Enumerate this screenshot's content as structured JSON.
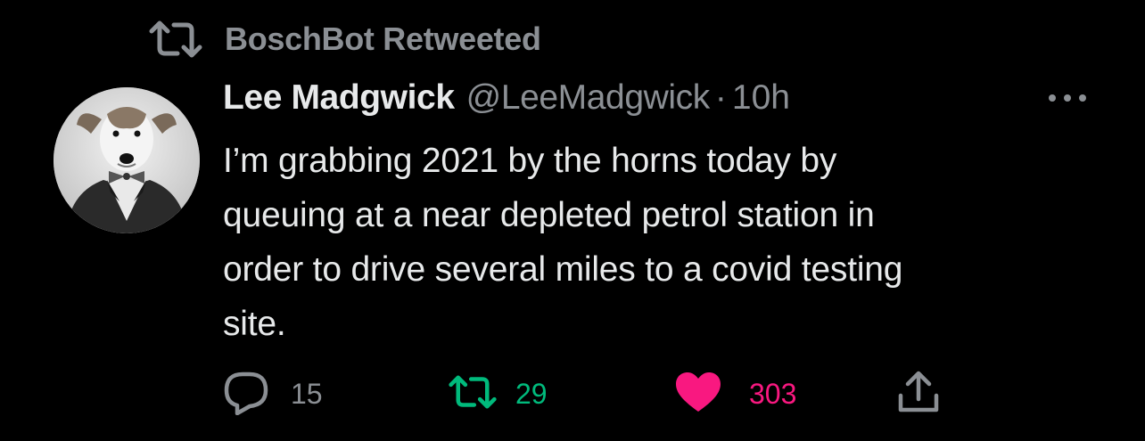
{
  "retweet_header": {
    "icon": "retweet-icon",
    "label": "BoschBot Retweeted"
  },
  "author": {
    "name": "Lee Madgwick",
    "handle": "@LeeMadgwick",
    "separator": "·",
    "time": "10h",
    "avatar": "dog-in-suit-avatar"
  },
  "tweet": {
    "lines": [
      "I’m grabbing 2021 by the horns today by",
      "queuing at a near depleted petrol station in",
      "order to drive several miles to a covid testing",
      "site."
    ]
  },
  "actions": {
    "reply": {
      "icon": "reply-icon",
      "count": "15"
    },
    "retweet": {
      "icon": "retweet-icon",
      "count": "29",
      "color": "#00ba7c"
    },
    "like": {
      "icon": "heart-icon",
      "count": "303",
      "color": "#f91880"
    },
    "share": {
      "icon": "share-icon"
    }
  },
  "colors": {
    "background": "#000000",
    "primary_text": "#e7e9ea",
    "secondary_text": "#8b8f94",
    "retweet_green": "#00ba7c",
    "like_pink": "#f91880"
  }
}
